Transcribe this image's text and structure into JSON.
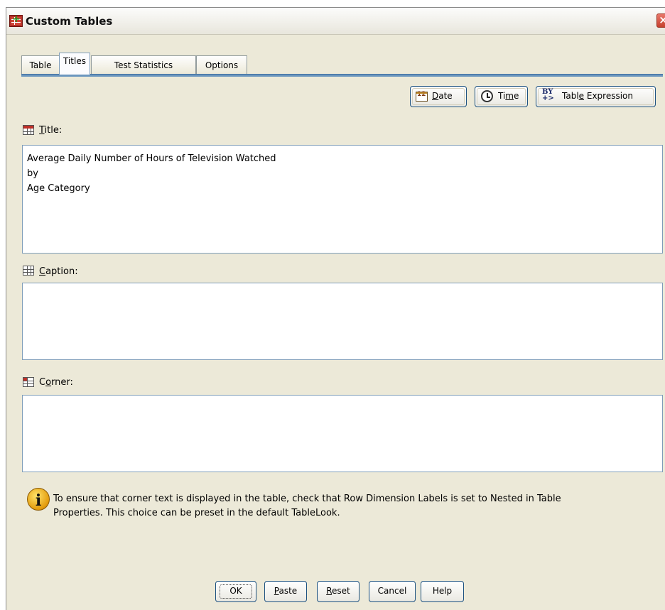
{
  "window": {
    "title": "Custom Tables",
    "close_glyph": "×"
  },
  "tabs": [
    {
      "label": "Table",
      "active": false
    },
    {
      "label": "Titles",
      "active": true
    },
    {
      "label": "Test Statistics",
      "active": false
    },
    {
      "label": "Options",
      "active": false
    }
  ],
  "insert_buttons": {
    "date": {
      "label": "Date",
      "mnemonic": "D",
      "icon": "calendar-icon"
    },
    "time": {
      "label": "Time",
      "mnemonic": "m",
      "icon": "clock-icon"
    },
    "table_expression": {
      "label": "Table Expression",
      "mnemonic": "e",
      "icon": "by-expression-icon",
      "icon_text_top": "BY",
      "icon_text_bottom": "+>"
    }
  },
  "title_section": {
    "label": "Title:",
    "mnemonic": "T",
    "lines": [
      "Average Daily Number of Hours of Television Watched",
      "by",
      "Age Category"
    ]
  },
  "caption_section": {
    "label": "Caption:",
    "mnemonic": "C",
    "lines": []
  },
  "corner_section": {
    "label": "Corner:",
    "mnemonic": "o",
    "lines": []
  },
  "info": {
    "icon": "info-icon",
    "glyph": "i",
    "line1": "To ensure that corner text is displayed in the table, check that Row Dimension Labels is set to Nested in Table",
    "line2": "Properties. This choice can be preset in the default TableLook."
  },
  "footer_buttons": {
    "ok": "OK",
    "paste": "Paste",
    "reset": "Reset",
    "cancel": "Cancel",
    "help": "Help"
  }
}
